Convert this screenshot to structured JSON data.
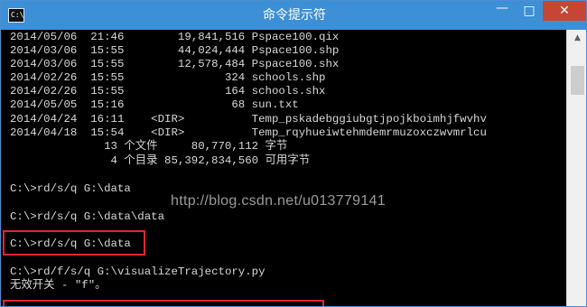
{
  "window": {
    "title": "命令提示符",
    "icon_text": "C:\\",
    "minimize_glyph": "—",
    "maximize_glyph": "□",
    "close_glyph": "✕"
  },
  "console": {
    "lines": [
      "2014/05/06  21:46        19,841,516 Pspace100.qix",
      "2014/03/06  15:55        44,024,444 Pspace100.shp",
      "2014/03/06  15:55        12,578,484 Pspace100.shx",
      "2014/02/26  15:55               324 schools.shp",
      "2014/02/26  15:55               164 schools.shx",
      "2014/05/05  15:16                68 sun.txt",
      "2014/04/24  16:11    <DIR>          Temp_pskadebggiubgtjpojkboimhjfwvhv",
      "2014/04/18  15:54    <DIR>          Temp_rqyhueiwtehmdemrmuzoxczwvmrlcu",
      "              13 个文件     80,770,112 字节",
      "               4 个目录 85,392,834,560 可用字节",
      "",
      "C:\\>rd/s/q G:\\data",
      "",
      "C:\\>rd/s/q G:\\data\\data",
      "",
      "C:\\>rd/s/q G:\\data",
      "",
      "C:\\>rd/f/s/q G:\\visualizeTrajectory.py",
      "无效开关 - \"f\"。"
    ]
  },
  "watermark": {
    "text": "http://blog.csdn.net/u013779141"
  },
  "scrollbar": {
    "up_arrow": "▲"
  }
}
